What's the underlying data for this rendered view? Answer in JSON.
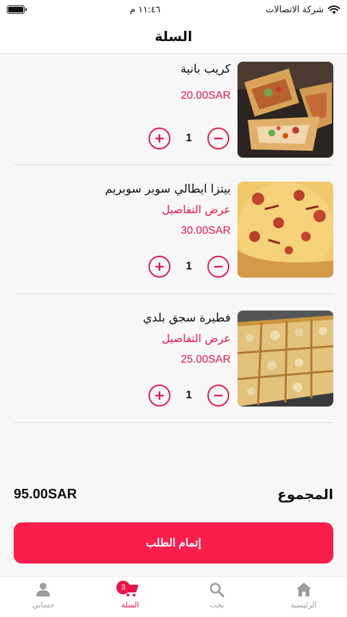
{
  "status_bar": {
    "carrier": "شركة الاتصالات",
    "time": "١١:٤٦ م"
  },
  "header": {
    "title": "السلة"
  },
  "cart": {
    "items": [
      {
        "name": "كريب بانية",
        "details": "",
        "price": "20.00SAR",
        "quantity": "1",
        "image": "crepe-panini-image"
      },
      {
        "name": "بيتزا ايطالي سوبر سوبريم",
        "details": "عرض التفاصيل",
        "price": "30.00SAR",
        "quantity": "1",
        "image": "pizza-super-supreme-image"
      },
      {
        "name": "فطيرة سجق بلدي",
        "details": "عرض التفاصيل",
        "price": "25.00SAR",
        "quantity": "1",
        "image": "sausage-pie-image"
      }
    ]
  },
  "summary": {
    "total_label": "المجموع",
    "total_amount": "95.00SAR"
  },
  "checkout": {
    "label": "إتمام الطلب"
  },
  "tabs": [
    {
      "label": "الرئيسية",
      "icon": "home-icon",
      "active": false
    },
    {
      "label": "بحث",
      "icon": "search-icon",
      "active": false
    },
    {
      "label": "السلة",
      "icon": "cart-icon",
      "active": true,
      "badge": "3"
    },
    {
      "label": "حسابي",
      "icon": "person-icon",
      "active": false
    }
  ],
  "colors": {
    "accent": "#e8174b",
    "button": "#fb1d4b",
    "inactive": "#9b9b9b"
  }
}
